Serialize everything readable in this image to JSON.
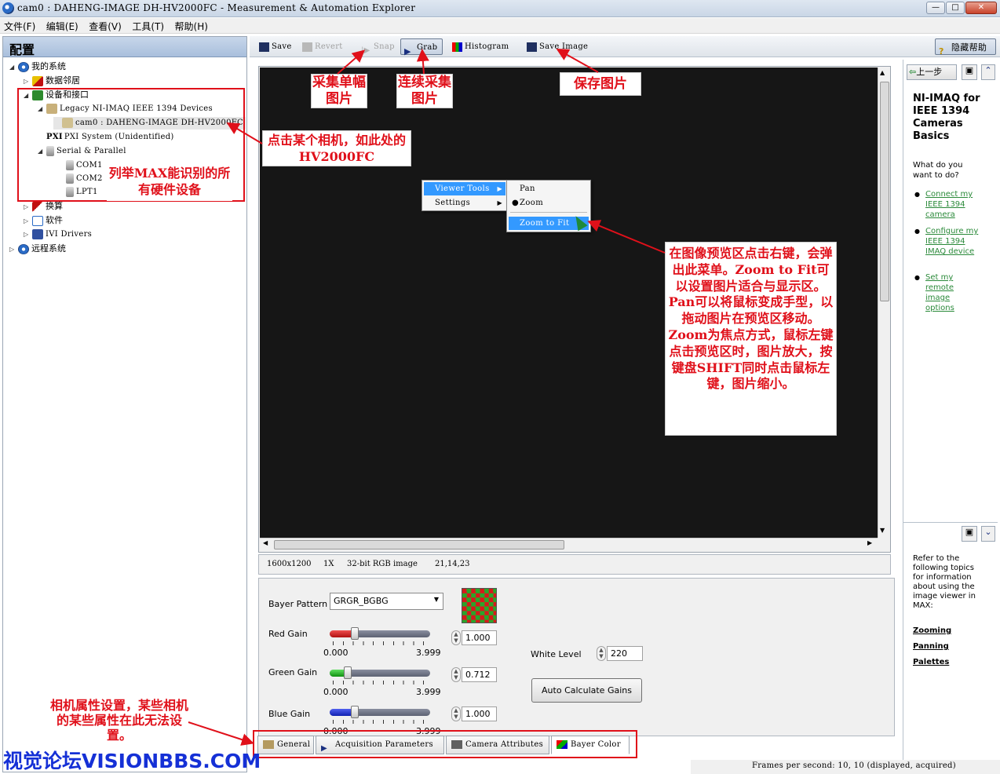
{
  "window": {
    "title": "cam0 : DAHENG-IMAGE DH-HV2000FC - Measurement & Automation Explorer",
    "buttons": {
      "minimize": "—",
      "maximize": "□",
      "close": "✕"
    }
  },
  "menubar": [
    "文件(F)",
    "编辑(E)",
    "查看(V)",
    "工具(T)",
    "帮助(H)"
  ],
  "config": {
    "header": "配置",
    "tree": [
      {
        "label": "我的系统"
      },
      {
        "label": "数据邻居"
      },
      {
        "label": "设备和接口"
      },
      {
        "label": "Legacy NI-IMAQ IEEE 1394 Devices"
      },
      {
        "label": "cam0 : DAHENG-IMAGE DH-HV2000FC"
      },
      {
        "label": "PXI System (Unidentified)"
      },
      {
        "label": "Serial & Parallel"
      },
      {
        "label": "COM1"
      },
      {
        "label": "COM2"
      },
      {
        "label": "LPT1"
      },
      {
        "label": "换算"
      },
      {
        "label": "软件"
      },
      {
        "label": "IVI Drivers"
      },
      {
        "label": "远程系统"
      }
    ]
  },
  "toolbar": {
    "save": "Save",
    "revert": "Revert",
    "snap": "Snap",
    "grab": "Grab",
    "histogram": "Histogram",
    "save_image": "Save Image",
    "hide_help": "隐藏帮助"
  },
  "viewer": {
    "status": {
      "size": "1600x1200",
      "zoom": "1X",
      "format": "32-bit RGB image",
      "pixel": "21,14,23"
    },
    "context_menu": {
      "items": [
        "Viewer Tools",
        "Settings"
      ],
      "submenu": [
        "Pan",
        "Zoom",
        "Zoom to Fit"
      ]
    }
  },
  "props": {
    "bayer_pattern_label": "Bayer Pattern",
    "bayer_pattern_value": "GRGR_BGBG",
    "red_gain_label": "Red Gain",
    "red_gain_value": "1.000",
    "red_gain": 0.25,
    "green_gain_label": "Green Gain",
    "green_gain_value": "0.712",
    "green_gain": 0.178,
    "blue_gain_label": "Blue Gain",
    "blue_gain_value": "1.000",
    "blue_gain": 0.25,
    "range_min": "0.000",
    "range_max": "3.999",
    "white_level_label": "White Level",
    "white_level_value": "220",
    "auto_gains": "Auto Calculate Gains"
  },
  "tabs": [
    "General",
    "Acquisition Parameters",
    "Camera Attributes",
    "Bayer Color"
  ],
  "help": {
    "back": "上一步",
    "title": "NI-IMAQ for IEEE 1394 Cameras Basics",
    "question": "What do you want to do?",
    "links": [
      "Connect my IEEE 1394 camera",
      "Configure my IEEE 1394 IMAQ device",
      "Set my remote image options"
    ],
    "refer": "Refer to the following topics for information about using the image viewer in MAX:",
    "topics": [
      "Zooming",
      "Panning",
      "Palettes"
    ]
  },
  "status_bar": "Frames per second: 10, 10 (displayed, acquired)",
  "annotations": {
    "snap": "采集单幅图片",
    "grab": "连续采集图片",
    "save_image": "保存图片",
    "camera": "点击某个相机，如此处的HV2000FC",
    "devices": "列举MAX能识别的所有硬件设备",
    "menu": "在图像预览区点击右键，会弹出此菜单。Zoom to Fit可以设置图片适合与显示区。Pan可以将鼠标变成手型，以拖动图片在预览区移动。Zoom为焦点方式，鼠标左键点击预览区时，图片放大，按键盘SHIFT同时点击鼠标左键，图片缩小。",
    "props": "相机属性设置，某些相机的某些属性在此无法设置。"
  },
  "watermark": "视觉论坛VISIONBBS.COM",
  "colors": {
    "annotation": "#e0101a",
    "viewer_bg": "#161616",
    "highlight": "#3399ff",
    "link": "#2b8a3a",
    "watermark": "#1530d6"
  }
}
